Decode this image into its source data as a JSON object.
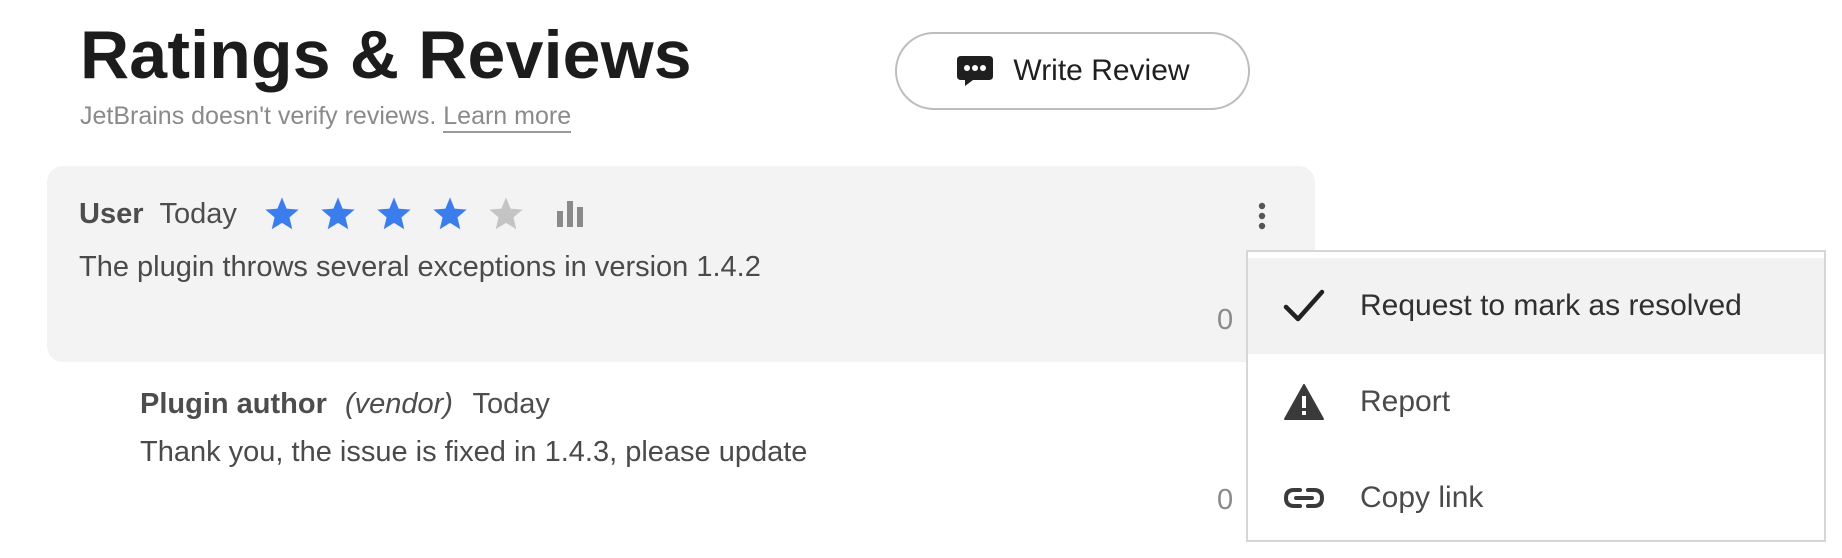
{
  "header": {
    "title": "Ratings & Reviews",
    "disclaimer": "JetBrains doesn't verify reviews.",
    "learn_more": "Learn more",
    "write_review_label": "Write Review"
  },
  "review": {
    "user": "User",
    "date": "Today",
    "rating": 4,
    "max_rating": 5,
    "text": "The plugin throws several exceptions in version 1.4.2",
    "count": "0"
  },
  "reply": {
    "author": "Plugin author",
    "role": "(vendor)",
    "date": "Today",
    "text": "Thank you, the issue is fixed in 1.4.3, please update",
    "count": "0"
  },
  "menu": {
    "items": [
      {
        "label": "Request to mark as resolved",
        "icon": "check-icon",
        "active": true
      },
      {
        "label": "Report",
        "icon": "warning-icon",
        "active": false
      },
      {
        "label": "Copy link",
        "icon": "link-icon",
        "active": false
      }
    ]
  },
  "colors": {
    "star_filled": "#3b7ded",
    "star_empty": "#c4c4c4",
    "card_bg": "#f3f3f3",
    "menu_active_bg": "#f2f2f2"
  }
}
